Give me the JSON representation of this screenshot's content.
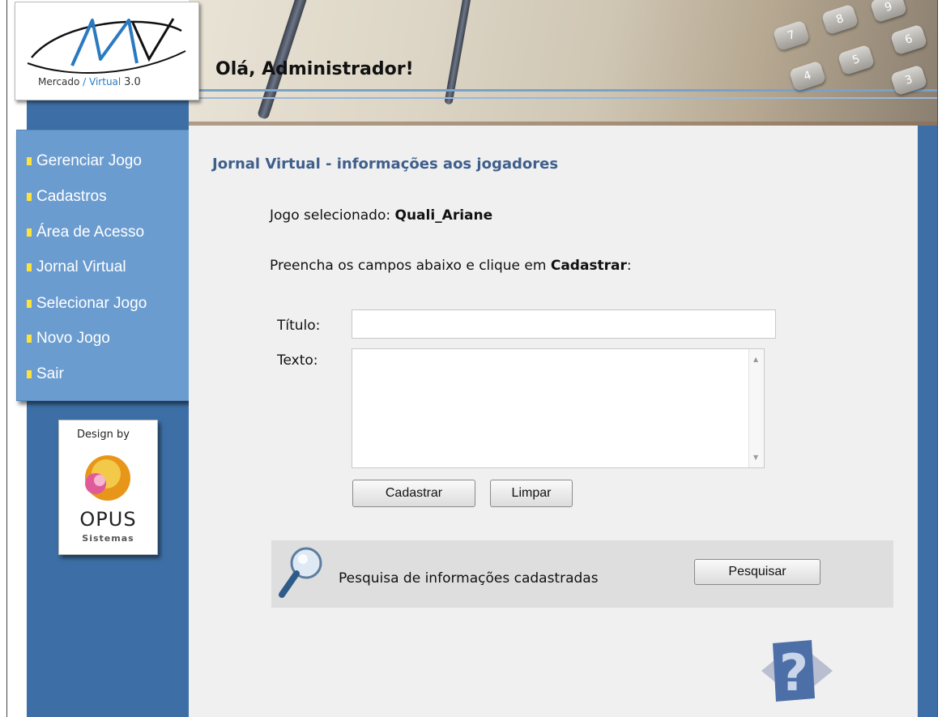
{
  "header": {
    "greeting": "Olá, Administrador!",
    "logo_mercado": "Mercado",
    "logo_virtual": "Virtual",
    "logo_version": "3.0",
    "keypad_keys": [
      "7",
      "8",
      "9",
      "6",
      "4",
      "5",
      "3"
    ]
  },
  "sidebar": {
    "items": [
      {
        "label": "Gerenciar Jogo"
      },
      {
        "label": "Cadastros"
      },
      {
        "label": "Área de Acesso"
      },
      {
        "label": "Jornal Virtual"
      },
      {
        "label": "Selecionar Jogo"
      },
      {
        "label": "Novo Jogo"
      },
      {
        "label": "Sair"
      }
    ],
    "design_by": "Design by",
    "opus_name": "OPUS",
    "opus_sub": "Sistemas"
  },
  "main": {
    "section_title": "Jornal Virtual - informações aos jogadores",
    "jogo_prefix": "Jogo selecionado: ",
    "jogo_value": "Quali_Ariane",
    "instr_prefix": "Preencha os campos abaixo e clique em ",
    "instr_bold": "Cadastrar",
    "instr_suffix": ":",
    "titulo_label": "Título:",
    "titulo_value": "",
    "texto_label": "Texto:",
    "texto_value": "",
    "cadastrar_label": "Cadastrar",
    "limpar_label": "Limpar"
  },
  "search": {
    "text": "Pesquisa de informações cadastradas",
    "button_label": "Pesquisar"
  },
  "colors": {
    "sidebar_blue": "#3d6fa6",
    "menu_blue": "#6b9cd0",
    "title_blue": "#3f5f8c",
    "bullet_yellow": "#ffe23a"
  },
  "icons": [
    "magnifier-icon",
    "help-icon",
    "opus-logo-icon",
    "mv-logo"
  ]
}
